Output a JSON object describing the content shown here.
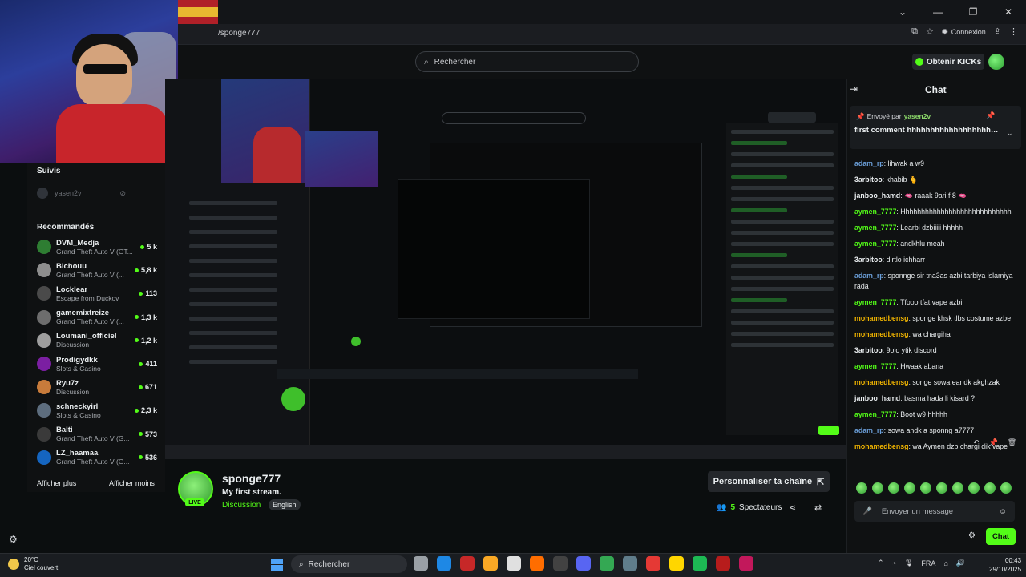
{
  "browser": {
    "url": "/sponge777",
    "connexion_label": "Connexion"
  },
  "header": {
    "search_placeholder": "Rechercher",
    "kicks_button": "Obtenir KICKs"
  },
  "sidebar": {
    "followed_title": "Suivis",
    "followed": [
      {
        "name": "yasen2v"
      }
    ],
    "recommended_title": "Recommandés",
    "recommended": [
      {
        "name": "DVM_Medja",
        "category": "Grand Theft Auto V (GT...",
        "viewers": "5 k",
        "color": "#2e7d32"
      },
      {
        "name": "Bichouu",
        "category": "Grand Theft Auto V (...",
        "viewers": "5,8 k",
        "color": "#8d8d8d"
      },
      {
        "name": "Locklear",
        "category": "Escape from Duckov",
        "viewers": "113",
        "color": "#4a4a4a"
      },
      {
        "name": "gamemixtreize",
        "category": "Grand Theft Auto V (...",
        "viewers": "1,3 k",
        "color": "#6d6d6d"
      },
      {
        "name": "Loumani_officiel",
        "category": "Discussion",
        "viewers": "1,2 k",
        "color": "#9e9e9e"
      },
      {
        "name": "Prodigydkk",
        "category": "Slots & Casino",
        "viewers": "411",
        "color": "#7b1fa2"
      },
      {
        "name": "Ryu7z",
        "category": "Discussion",
        "viewers": "671",
        "color": "#c77b3b"
      },
      {
        "name": "schneckyirl",
        "category": "Slots & Casino",
        "viewers": "2,3 k",
        "color": "#5d6d7e"
      },
      {
        "name": "Balti",
        "category": "Grand Theft Auto V (G...",
        "viewers": "573",
        "color": "#3a3a3a"
      },
      {
        "name": "LZ_haamaa",
        "category": "Grand Theft Auto V (G...",
        "viewers": "536",
        "color": "#1565c0"
      }
    ],
    "show_more": "Afficher plus",
    "show_less": "Afficher moins"
  },
  "channel": {
    "name": "sponge777",
    "live_badge": "LIVE",
    "title": "My first stream.",
    "category": "Discussion",
    "language": "English",
    "customize_button": "Personnaliser ta chaîne",
    "viewers_count": "5",
    "viewers_label": "Spectateurs"
  },
  "chat": {
    "title": "Chat",
    "pinned_by_label": "Envoyé par",
    "pinned_by_user": "yasen2v",
    "pinned_message": "first comment hhhhhhhhhhhhhhhhhhhhhhhhhhhhhhh...",
    "messages": [
      {
        "user": "adam_rp",
        "color": "#6b9fd9",
        "text": "lihwak a w9"
      },
      {
        "user": "3arbitoo",
        "color": "#e9edef",
        "text": "khabib 🫰"
      },
      {
        "user": "janboo_hamd",
        "color": "#e9edef",
        "text": "🫦 raaak 9ari f 8 🫦"
      },
      {
        "user": "aymen_7777",
        "color": "#53fc18",
        "text": "Hhhhhhhhhhhhhhhhhhhhhhhhhhhh"
      },
      {
        "user": "aymen_7777",
        "color": "#53fc18",
        "text": "Learbi dzbiiiii hhhhh"
      },
      {
        "user": "aymen_7777",
        "color": "#53fc18",
        "text": "andkhlu meah"
      },
      {
        "user": "3arbitoo",
        "color": "#e9edef",
        "text": "dirtlo ichharr"
      },
      {
        "user": "adam_rp",
        "color": "#6b9fd9",
        "text": "sponnge sir tna3as azbi tarbiya islamiya rada"
      },
      {
        "user": "aymen_7777",
        "color": "#53fc18",
        "text": "Tfooo tfat vape azbi"
      },
      {
        "user": "mohamedbensg",
        "color": "#f0b400",
        "text": "sponge khsk tlbs costume azbe"
      },
      {
        "user": "mohamedbensg",
        "color": "#f0b400",
        "text": "wa chargiha"
      },
      {
        "user": "3arbitoo",
        "color": "#e9edef",
        "text": "9olo ytik discord"
      },
      {
        "user": "aymen_7777",
        "color": "#53fc18",
        "text": "Hwaak abana"
      },
      {
        "user": "mohamedbensg",
        "color": "#f0b400",
        "text": "songe sowa eandk akghzak"
      },
      {
        "user": "janboo_hamd",
        "color": "#e9edef",
        "text": "basma hada li kisard ?"
      },
      {
        "user": "aymen_7777",
        "color": "#53fc18",
        "text": "Boot w9 hhhhh"
      },
      {
        "user": "adam_rp",
        "color": "#6b9fd9",
        "text": "sowa andk a sponng a7777"
      },
      {
        "user": "mohamedbensg",
        "color": "#f0b400",
        "text": "wa Aymen dzb chargi dik vape"
      }
    ],
    "input_placeholder": "Envoyer un message",
    "send_button": "Chat"
  },
  "taskbar": {
    "temperature": "20°C",
    "weather": "Ciel couvert",
    "search_label": "Rechercher",
    "language": "FRA",
    "time": "00:43",
    "date": "29/10/2025",
    "app_colors": [
      "#9aa0a6",
      "#1e88e5",
      "#c62828",
      "#f9a825",
      "#e0e0e0",
      "#ff6d00",
      "#424242",
      "#5865f2",
      "#34a853",
      "#607d8b",
      "#e53935",
      "#ffd600",
      "#1db954",
      "#b71c1c",
      "#c2185b"
    ]
  }
}
